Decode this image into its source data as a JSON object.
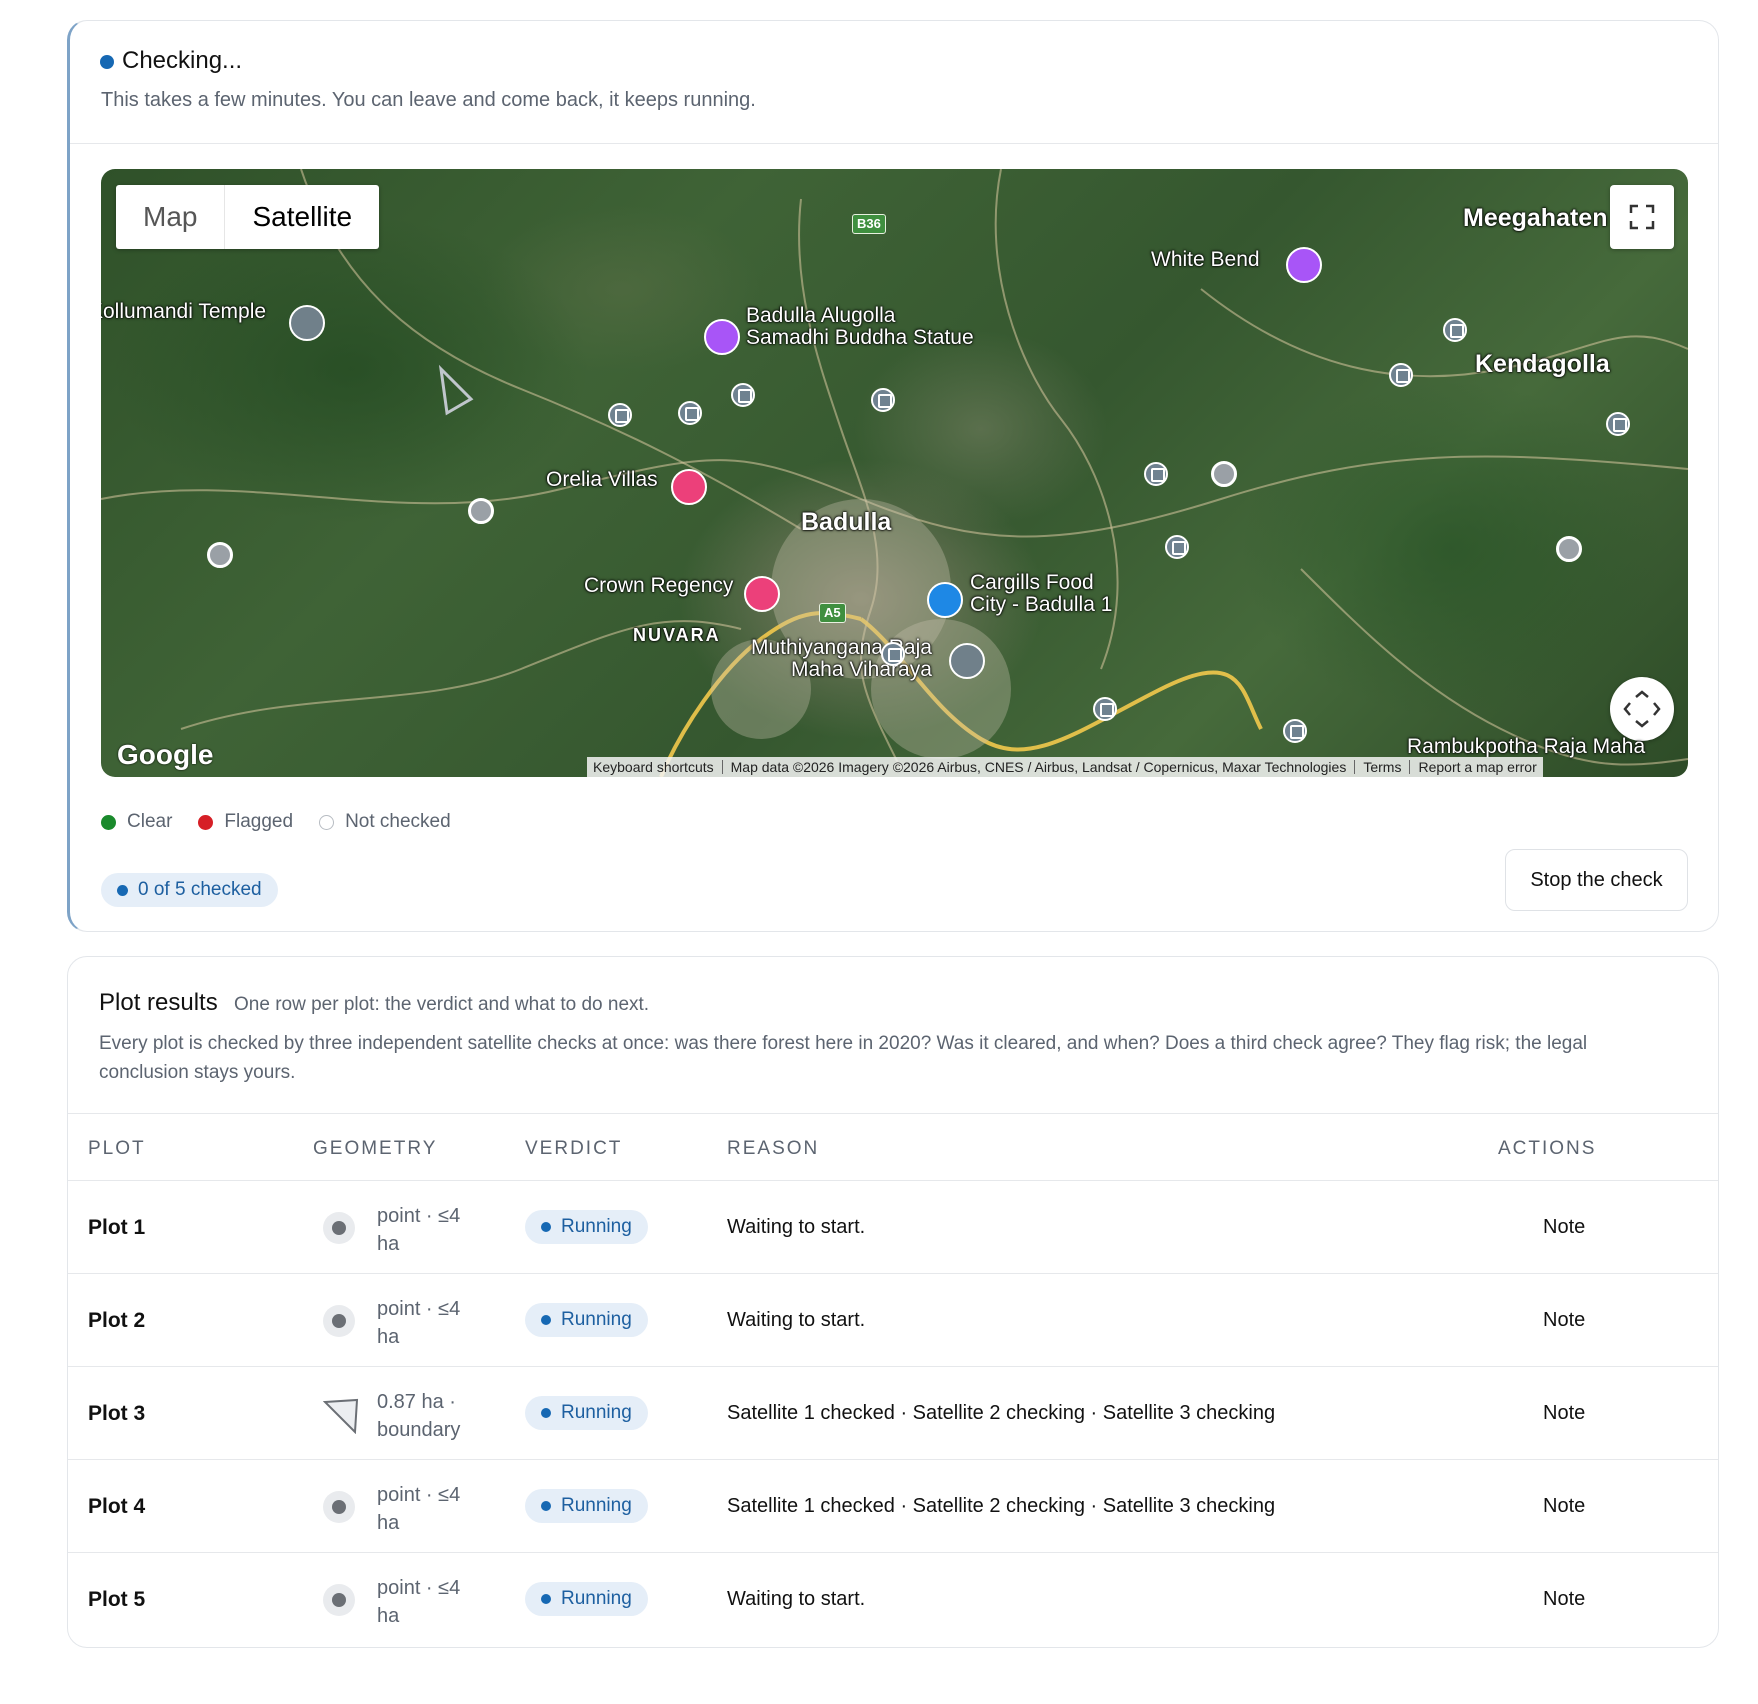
{
  "status": {
    "title": "Checking...",
    "subtitle": "This takes a few minutes. You can leave and come back, it keeps running.",
    "color": "#1668b3"
  },
  "map": {
    "toggle": {
      "map_label": "Map",
      "satellite_label": "Satellite",
      "selected": "Satellite"
    },
    "labels": {
      "meegahaten": "Meegahaten",
      "white_bend": "White Bend",
      "kollumandi": "Kollumandi Temple",
      "alugolla_1": "Badulla Alugolla",
      "alugolla_2": "Samadhi Buddha Statue",
      "kendagolla": "Kendagolla",
      "orelia": "Orelia Villas",
      "badulla": "Badulla",
      "crown": "Crown Regency",
      "cargills_1": "Cargills Food",
      "cargills_2": "City - Badulla 1",
      "nuvara": "NUVARA",
      "muthiyangana_1": "Muthiyangana Raja",
      "muthiyangana_2": "Maha Viharaya",
      "rambukpotha": "Rambukpotha Raja Maha"
    },
    "shields": {
      "b36": "B36",
      "a5": "A5"
    },
    "google": "Google",
    "footer": {
      "shortcuts": "Keyboard shortcuts",
      "data": "Map data ©2026 Imagery ©2026 Airbus, CNES / Airbus, Landsat / Copernicus, Maxar Technologies",
      "terms": "Terms",
      "report": "Report a map error"
    },
    "icons": {
      "fullscreen": "fullscreen-icon",
      "camera": "camera-control-icon"
    }
  },
  "legend": {
    "clear": "Clear",
    "flagged": "Flagged",
    "not_checked": "Not checked",
    "colors": {
      "clear": "#1a8a2c",
      "flagged": "#d61f26"
    }
  },
  "progress": {
    "label": "0 of 5 checked",
    "checked": 0,
    "total": 5
  },
  "stop_button": "Stop the check",
  "results": {
    "title": "Plot results",
    "subtitle": "One row per plot: the verdict and what to do next.",
    "description": "Every plot is checked by three independent satellite checks at once: was there forest here in 2020? Was it cleared, and when? Does a third check agree? They flag risk; the legal conclusion stays yours.",
    "columns": {
      "plot": "PLOT",
      "geometry": "GEOMETRY",
      "verdict": "VERDICT",
      "reason": "REASON",
      "actions": "ACTIONS"
    },
    "rows": [
      {
        "plot": "Plot 1",
        "geometry_type": "point",
        "geometry": "point · ≤4 ha",
        "verdict": "Running",
        "reason": "Waiting to start.",
        "action": "Note"
      },
      {
        "plot": "Plot 2",
        "geometry_type": "point",
        "geometry": "point · ≤4 ha",
        "verdict": "Running",
        "reason": "Waiting to start.",
        "action": "Note"
      },
      {
        "plot": "Plot 3",
        "geometry_type": "polygon",
        "geometry": "0.87 ha · boundary",
        "verdict": "Running",
        "reason": "Satellite 1 checked · Satellite 2 checking · Satellite 3 checking",
        "action": "Note"
      },
      {
        "plot": "Plot 4",
        "geometry_type": "point",
        "geometry": "point · ≤4 ha",
        "verdict": "Running",
        "reason": "Satellite 1 checked · Satellite 2 checking · Satellite 3 checking",
        "action": "Note"
      },
      {
        "plot": "Plot 5",
        "geometry_type": "point",
        "geometry": "point · ≤4 ha",
        "verdict": "Running",
        "reason": "Waiting to start.",
        "action": "Note"
      }
    ]
  }
}
